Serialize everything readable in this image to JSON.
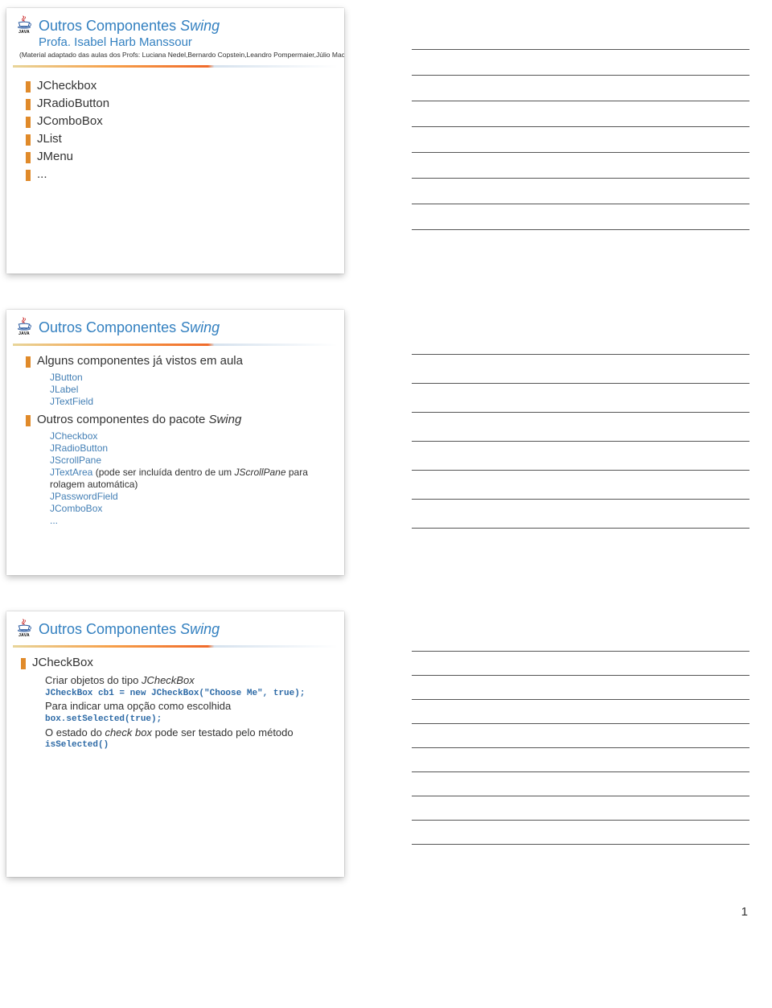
{
  "iconCaption": "JAVA",
  "slide1": {
    "title_prefix": "Outros Componentes ",
    "title_italic": "Swing",
    "subtitle": "Profa. Isabel Harb Manssour",
    "credits": "(Material adaptado das aulas dos Profs: Luciana Nedel,Bernardo Copstein,Leandro Pompermaier,Júlio Machado)",
    "bullets": [
      "JCheckbox",
      "JRadioButton",
      "JComboBox",
      "JList",
      "JMenu",
      "..."
    ]
  },
  "slide2": {
    "title_prefix": "Outros Componentes ",
    "title_italic": "Swing",
    "group1_head": "Alguns componentes já vistos em aula",
    "group1_items": [
      "JButton",
      "JLabel",
      "JTextField"
    ],
    "group2_head_prefix": "Outros componentes do pacote ",
    "group2_head_italic": "Swing",
    "group2_items_1": "JCheckbox",
    "group2_items_2": "JRadioButton",
    "group2_items_3": "JScrollPane",
    "group2_items_4a": "JTextArea ",
    "group2_items_4b": "(pode ser incluída dentro de um ",
    "group2_items_4c": "JScrollPane",
    "group2_items_4d": " para rolagem automática)",
    "group2_items_5": "JPasswordField",
    "group2_items_6": "JComboBox",
    "group2_items_7": "..."
  },
  "slide3": {
    "title_prefix": "Outros Componentes ",
    "title_italic": "Swing",
    "main": "JCheckBox",
    "line1_a": "Criar objetos do tipo ",
    "line1_b": "JCheckBox",
    "code1": "JCheckBox cb1 = new JCheckBox(\"Choose Me\", true);",
    "line2": "Para indicar uma opção como escolhida",
    "code2": "box.setSelected(true);",
    "line3_a": "O estado do ",
    "line3_b": "check box",
    "line3_c": " pode ser testado pelo método",
    "code3": "isSelected()"
  },
  "pageNumber": "1"
}
